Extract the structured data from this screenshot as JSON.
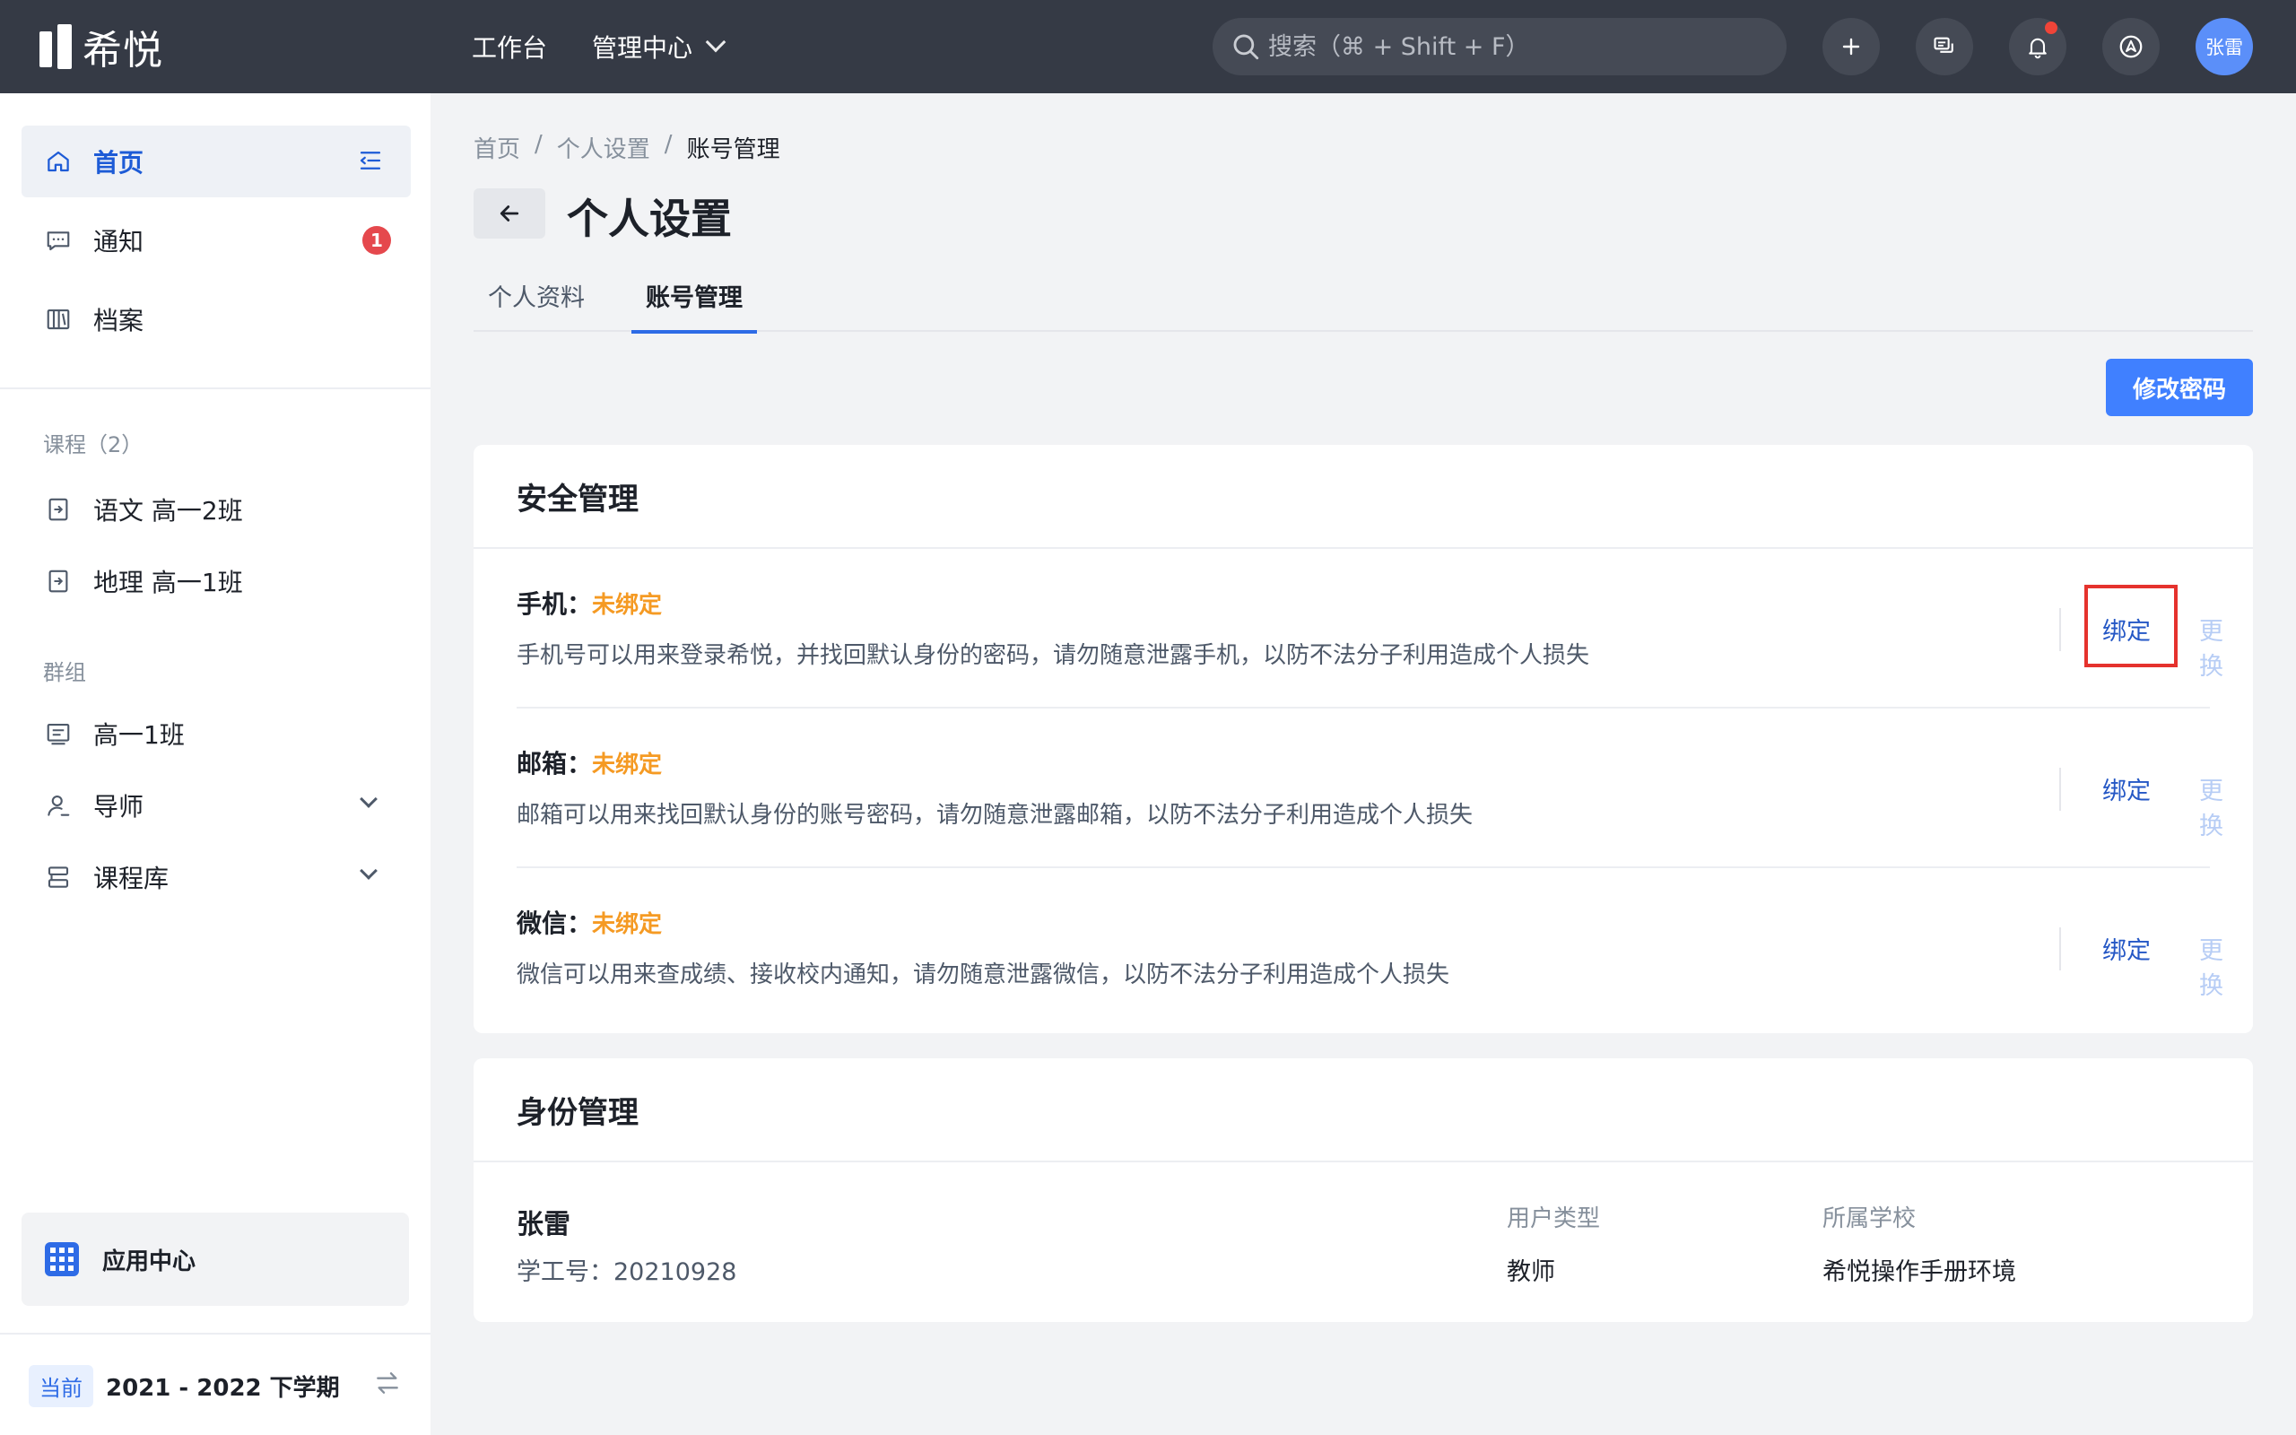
{
  "app": {
    "name": "希悦"
  },
  "topnav": {
    "workbench": "工作台",
    "admin_center": "管理中心"
  },
  "search": {
    "placeholder": "搜索（⌘ + Shift + F）"
  },
  "user": {
    "avatar_text": "张雷"
  },
  "sidebar": {
    "home": "首页",
    "notice": "通知",
    "notice_badge": "1",
    "archive": "档案",
    "courses_label": "课程（2）",
    "courses": [
      "语文 高一2班",
      "地理 高一1班"
    ],
    "groups_label": "群组",
    "group_class": "高一1班",
    "tutor": "导师",
    "course_lib": "课程库",
    "app_center": "应用中心",
    "term_tag": "当前",
    "term_text": "2021 - 2022 下学期"
  },
  "breadcrumb": {
    "home": "首页",
    "sep": "/",
    "settings": "个人设置",
    "current": "账号管理"
  },
  "page": {
    "title": "个人设置"
  },
  "tabs": {
    "profile": "个人资料",
    "account": "账号管理"
  },
  "actions": {
    "change_password": "修改密码"
  },
  "security": {
    "title": "安全管理",
    "items": [
      {
        "label": "手机：",
        "status": "未绑定",
        "desc": "手机号可以用来登录希悦，并找回默认身份的密码，请勿随意泄露手机，以防不法分子利用造成个人损失",
        "bind": "绑定",
        "change": "更换"
      },
      {
        "label": "邮箱：",
        "status": "未绑定",
        "desc": "邮箱可以用来找回默认身份的账号密码，请勿随意泄露邮箱，以防不法分子利用造成个人损失",
        "bind": "绑定",
        "change": "更换"
      },
      {
        "label": "微信：",
        "status": "未绑定",
        "desc": "微信可以用来查成绩、接收校内通知，请勿随意泄露微信，以防不法分子利用造成个人损失",
        "bind": "绑定",
        "change": "更换"
      }
    ]
  },
  "identity": {
    "title": "身份管理",
    "name": "张雷",
    "staff_no": "学工号：20210928",
    "type_label": "用户类型",
    "type_value": "教师",
    "school_label": "所属学校",
    "school_value": "希悦操作手册环境"
  }
}
